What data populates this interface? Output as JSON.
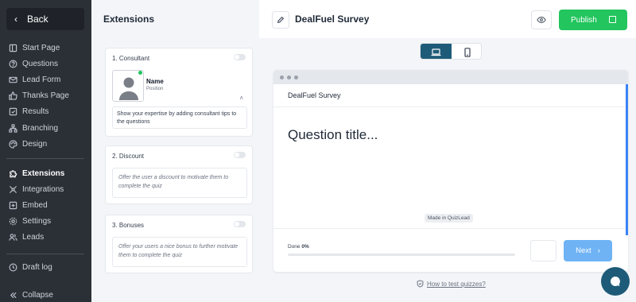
{
  "sidebar": {
    "back_label": "Back",
    "items": [
      {
        "label": "Start Page",
        "icon": "page-icon"
      },
      {
        "label": "Questions",
        "icon": "question-icon"
      },
      {
        "label": "Lead Form",
        "icon": "mail-icon"
      },
      {
        "label": "Thanks Page",
        "icon": "thumbs-up-icon"
      },
      {
        "label": "Results",
        "icon": "results-icon"
      },
      {
        "label": "Branching",
        "icon": "branching-icon"
      },
      {
        "label": "Design",
        "icon": "palette-icon"
      }
    ],
    "items2": [
      {
        "label": "Extensions",
        "icon": "puzzle-icon",
        "active": true
      },
      {
        "label": "Integrations",
        "icon": "integrations-icon"
      },
      {
        "label": "Embed",
        "icon": "embed-icon"
      },
      {
        "label": "Settings",
        "icon": "gear-icon"
      },
      {
        "label": "Leads",
        "icon": "users-icon"
      }
    ],
    "draft_log": "Draft log",
    "collapse": "Collapse"
  },
  "extensions": {
    "title": "Extensions",
    "consultant": {
      "heading": "1. Consultant",
      "name": "Name",
      "position": "Position",
      "tip": "Show your expertise by adding consultant tips to the questions"
    },
    "discount": {
      "heading": "2. Discount",
      "text": "Offer the user a discount to motivate them to complete the quiz"
    },
    "bonuses": {
      "heading": "3. Bonuses",
      "text": "Offer your users a nice bonus to further motivate them to complete the quiz"
    }
  },
  "topbar": {
    "survey_title": "DealFuel Survey",
    "publish_label": "Publish"
  },
  "preview": {
    "window_title": "DealFuel Survey",
    "question": "Question title...",
    "made_in": "Made in QuizLead",
    "done_label": "Done",
    "done_value": "0%",
    "progress": 0,
    "next_label": "Next"
  },
  "help": {
    "how_to": "How to test quizzes?"
  },
  "colors": {
    "sidebar_bg": "#2b2f36",
    "publish_green": "#22c55e",
    "next_blue": "#6fb3f5",
    "accent_teal": "#1e5b78"
  }
}
